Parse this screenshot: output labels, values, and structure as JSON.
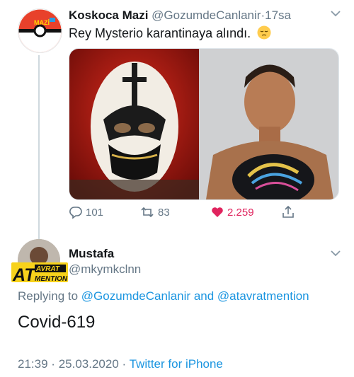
{
  "tweet": {
    "author_name": "Koskoca Mazi",
    "author_handle": "@GozumdeCanlanir",
    "separator": "·",
    "time_ago": "17sa",
    "text": "Rey Mysterio karantinaya alındı.",
    "emoji": "pensive-face",
    "avatar_text": "MAZİ",
    "actions": {
      "reply_count": "101",
      "retweet_count": "83",
      "like_count": "2.259"
    },
    "colors": {
      "like": "#e0245e",
      "muted": "#657786"
    }
  },
  "reply": {
    "author_name": "Mustafa",
    "author_handle": "@mkymkclnn",
    "badge_text_big": "AT",
    "badge_text_top": "AVRAT",
    "badge_text_bottom": "MENTION",
    "replying_prefix": "Replying to",
    "replying_user1": "@GozumdeCanlanir",
    "replying_and": "and",
    "replying_user2": "@atavratmention",
    "text": "Covid-619",
    "time": "21:39",
    "date": "25.03.2020",
    "separator": "·",
    "source": "Twitter for iPhone",
    "colors": {
      "link": "#1b95e0"
    }
  }
}
